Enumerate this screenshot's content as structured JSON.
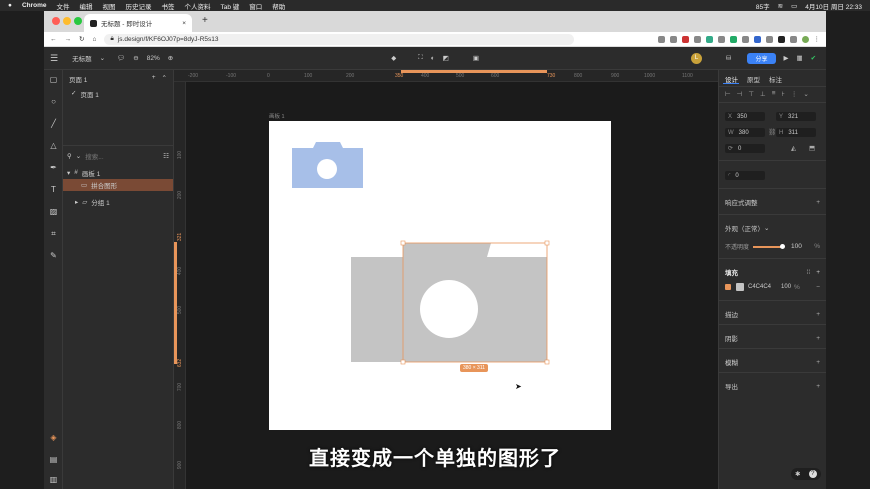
{
  "macbar": {
    "app": "Chrome",
    "menus": [
      "文件",
      "编辑",
      "视图",
      "历史记录",
      "书签",
      "个人资料",
      "Tab 键",
      "窗口",
      "帮助"
    ],
    "status": [
      "85字"
    ],
    "datetime": "4月10日 周日 22:33"
  },
  "browser": {
    "tab_title": "无标题 - 即时设计",
    "url": "js.design/f/KF6OJ07p=8dyJ-R5s13"
  },
  "appbar": {
    "file_name": "无标题",
    "zoom": "82%",
    "share_label": "分享",
    "avatar": "L"
  },
  "layers": {
    "pages_label": "页面 1",
    "page_item": "页面 1",
    "search_placeholder": "搜索...",
    "items": [
      {
        "label": "画板 1"
      },
      {
        "label": "拼合图形"
      },
      {
        "label": "分组 1"
      }
    ]
  },
  "canvas": {
    "artboard_label": "画板 1",
    "h_ticks": [
      "-200",
      "-100",
      "0",
      "100",
      "200",
      "350",
      "400",
      "500",
      "600",
      "730",
      "800",
      "900",
      "1000",
      "1100"
    ],
    "v_ticks": [
      "100",
      "200",
      "321",
      "400",
      "500",
      "632",
      "700",
      "800",
      "900"
    ],
    "size_badge": "380 × 311"
  },
  "subtitle": "直接变成一个单独的图形了",
  "right_panel": {
    "tabs": [
      "设计",
      "原型",
      "标注"
    ],
    "x_label": "X",
    "x_value": "350",
    "y_label": "Y",
    "y_value": "321",
    "w_label": "W",
    "w_value": "380",
    "h_label": "H",
    "h_value": "311",
    "rotation": "0",
    "radius": "0",
    "responsive": "响应式调整",
    "appearance": "外观（正常）",
    "opacity_label": "不透明度",
    "opacity_value": "100",
    "opacity_unit": "%",
    "fill_label": "填充",
    "fill_hex": "C4C4C4",
    "fill_opacity": "100",
    "fill_unit": "%",
    "stroke": "描边",
    "shadow": "阴影",
    "blur": "模糊",
    "export": "导出"
  },
  "colors": {
    "accent": "#3b82f6",
    "selection": "#e8955a",
    "fill": "#c4c4c4",
    "blue_camera": "#a7bfe8"
  }
}
